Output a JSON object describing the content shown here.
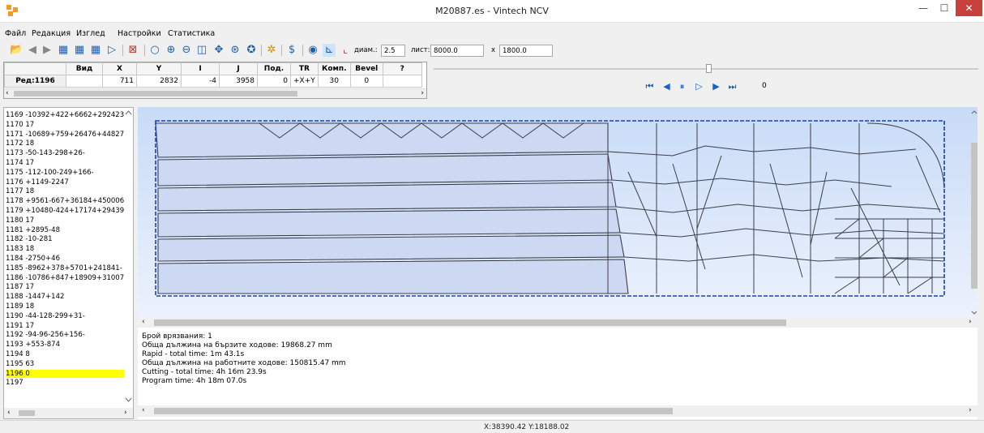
{
  "window": {
    "title": "M20887.es - Vintech NCV",
    "min_glyph": "—",
    "max_glyph": "☐",
    "close_glyph": "✕"
  },
  "menu": [
    "Файл",
    "Редакция",
    "Изглед",
    "Настройки",
    "Статистика"
  ],
  "toolbar": {
    "diam_label": "диам.:",
    "diam_value": "2.5",
    "sheet_label": "лист:",
    "sheet_w": "8000.0",
    "sheet_x": "x",
    "sheet_h": "1800.0",
    "icons": [
      "open-icon",
      "step-back-icon",
      "step-forward-icon",
      "save-icon",
      "save-as-icon",
      "save-all-icon",
      "run-icon",
      "inspect-icon",
      "zoom-icon",
      "zoom-in-icon",
      "zoom-out-icon",
      "zoom-fit-icon",
      "pan-icon",
      "zoom-window-icon",
      "zoom-prev-icon",
      "settings-icon",
      "cost-icon",
      "view-icon",
      "axes-icon",
      "origin-icon"
    ]
  },
  "grid": {
    "headers": [
      "",
      "Вид",
      "X",
      "Y",
      "I",
      "J",
      "Под.",
      "TR",
      "Комп.",
      "Bevel",
      "?"
    ],
    "row": [
      "Ред:1196",
      "",
      "711",
      "2832",
      "-4",
      "3958",
      "0",
      "+X+Y",
      "30",
      "0",
      ""
    ]
  },
  "player": {
    "counter": "0"
  },
  "program_lines": [
    "1169 -10392+422+6662+292423",
    "1170 17",
    "1171 -10689+759+26476+44827",
    "1172 18",
    "1173 -50-143-298+26-",
    "1174 17",
    "1175 -112-100-249+166-",
    "1176 +1149-2247",
    "1177 18",
    "1178 +9561-667+36184+450006",
    "1179 +10480-424+17174+29439",
    "1180 17",
    "1181 +2895-48",
    "1182 -10-281",
    "1183 18",
    "1184 -2750+46",
    "1185 -8962+378+5701+241841-",
    "1186 -10786+847+18909+31007",
    "1187 17",
    "1188 -1447+142",
    "1189 18",
    "1190 -44-128-299+31-",
    "1191 17",
    "1192 -94-96-256+156-",
    "1193 +553-874",
    "1194 8",
    "1195 63",
    "1196 0",
    "1197"
  ],
  "selected_line": 27,
  "info": [
    "Брой врязвания: 1",
    "Обща дължина на бързите ходове: 19868.27 mm",
    "Rapid - total time: 1m 43.1s",
    "Обща дължина на работните ходове: 150815.47 mm",
    "Cutting - total time: 4h 16m 23.9s",
    "Program time: 4h 18m 07.0s"
  ],
  "status": {
    "coords": "X:38390.42 Y:18188.02"
  },
  "colors": {
    "canvas_top": "#c8dbf7",
    "canvas_bottom": "#ecf2fd",
    "sheet_border": "#1a3fb8",
    "highlight": "#ffff00",
    "close_btn": "#c7413c"
  }
}
